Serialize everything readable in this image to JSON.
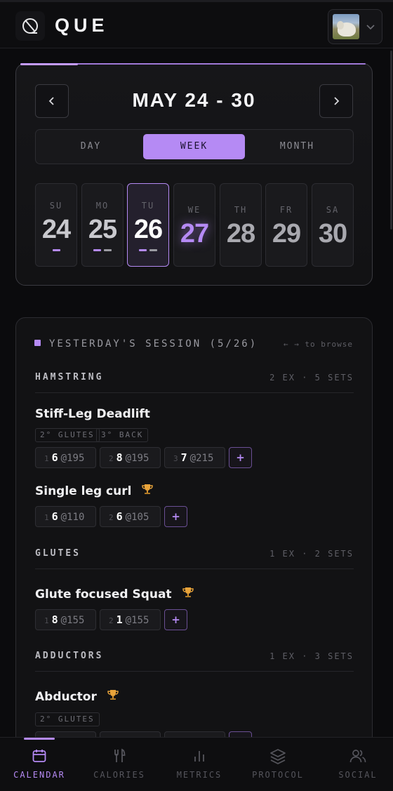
{
  "app": {
    "brand": "QUE"
  },
  "calendar": {
    "range_title": "MAY 24 - 30",
    "view_options": [
      "DAY",
      "WEEK",
      "MONTH"
    ],
    "active_view": "WEEK",
    "days": [
      {
        "name": "SU",
        "date": "24",
        "sessions": 1,
        "state": "past"
      },
      {
        "name": "MO",
        "date": "25",
        "sessions": 2,
        "state": "past"
      },
      {
        "name": "TU",
        "date": "26",
        "sessions": 2,
        "state": "today"
      },
      {
        "name": "WE",
        "date": "27",
        "sessions": 0,
        "state": "highlight"
      },
      {
        "name": "TH",
        "date": "28",
        "sessions": 0,
        "state": "future"
      },
      {
        "name": "FR",
        "date": "29",
        "sessions": 0,
        "state": "future"
      },
      {
        "name": "SA",
        "date": "30",
        "sessions": 0,
        "state": "future"
      }
    ]
  },
  "session": {
    "title": "YESTERDAY'S SESSION (5/26)",
    "browse_hint": "← → to browse",
    "groups": [
      {
        "name": "HAMSTRING",
        "meta": "2 EX · 5 SETS"
      },
      {
        "name": "GLUTES",
        "meta": "1 EX · 2 SETS"
      },
      {
        "name": "ADDUCTORS",
        "meta": "1 EX · 3 SETS"
      }
    ],
    "exercises": [
      {
        "name": "Stiff-Leg Deadlift",
        "tags": [
          "2° GLUTES",
          "3° BACK"
        ],
        "sets": [
          {
            "idx": "1",
            "reps": "6",
            "weight": "@195"
          },
          {
            "idx": "2",
            "reps": "8",
            "weight": "@195"
          },
          {
            "idx": "3",
            "reps": "7",
            "weight": "@215"
          }
        ]
      },
      {
        "name": "Single leg curl",
        "sets": [
          {
            "idx": "1",
            "reps": "6",
            "weight": "@110"
          },
          {
            "idx": "2",
            "reps": "6",
            "weight": "@105"
          }
        ]
      },
      {
        "name": "Glute focused Squat",
        "sets": [
          {
            "idx": "1",
            "reps": "8",
            "weight": "@155"
          },
          {
            "idx": "2",
            "reps": "1",
            "weight": "@155"
          }
        ]
      },
      {
        "name": "Abductor",
        "tags": [
          "2° GLUTES"
        ]
      }
    ],
    "add_label": "+"
  },
  "nav": {
    "tabs": [
      {
        "label": "CALENDAR",
        "icon": "calendar-icon",
        "active": true
      },
      {
        "label": "CALORIES",
        "icon": "fork-knife-icon"
      },
      {
        "label": "METRICS",
        "icon": "bar-chart-icon"
      },
      {
        "label": "PROTOCOL",
        "icon": "layers-icon"
      },
      {
        "label": "SOCIAL",
        "icon": "users-icon"
      }
    ]
  },
  "colors": {
    "accent": "#b58af4",
    "background": "#0b0b0d"
  }
}
